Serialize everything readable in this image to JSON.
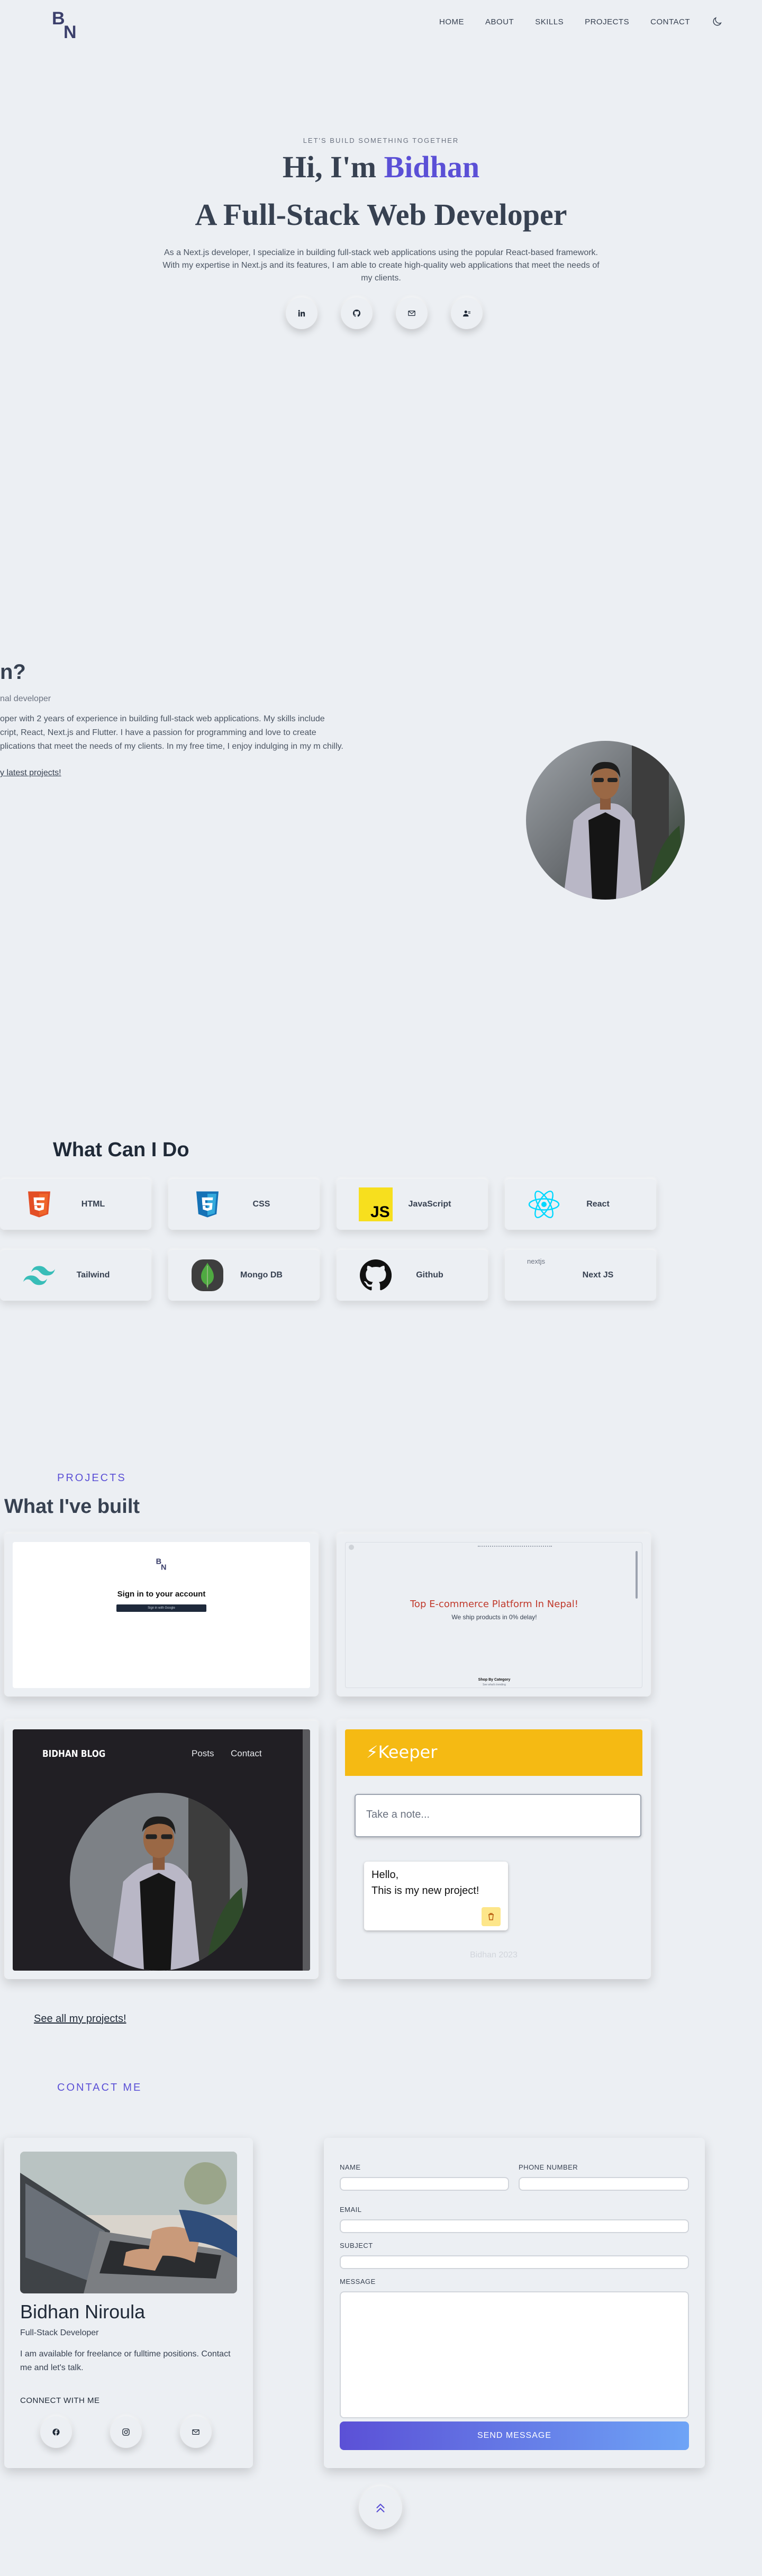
{
  "nav": {
    "logo_text": "BN",
    "items": [
      {
        "label": "HOME"
      },
      {
        "label": "ABOUT"
      },
      {
        "label": "SKILLS"
      },
      {
        "label": "PROJECTS"
      },
      {
        "label": "CONTACT"
      }
    ],
    "theme_icon": "moon-icon"
  },
  "hero": {
    "kicker": "LET'S BUILD SOMETHING TOGETHER",
    "greeting": "Hi, I'm ",
    "name": "Bidhan",
    "title": "A Full-Stack Web Developer",
    "description": "As a Next.js developer, I specialize in building full-stack web applications using the popular React-based framework. With my expertise in Next.js and its features, I am able to create high-quality web applications that meet the needs of my clients.",
    "socials": [
      {
        "icon": "linkedin-icon"
      },
      {
        "icon": "github-icon"
      },
      {
        "icon": "mail-icon"
      },
      {
        "icon": "contact-card-icon"
      }
    ]
  },
  "about": {
    "heading": "n?",
    "subheading": "nal developer",
    "paragraph": "oper with 2 years of experience in building full-stack web applications. My skills include cript, React, Next.js and Flutter. I have a passion for programming and love to create plications that meet the needs of my clients. In my free time, I enjoy indulging in my m chilly.",
    "link": "y latest projects!"
  },
  "skills": {
    "heading": "What Can I Do",
    "items": [
      {
        "label": "HTML",
        "icon": "html5-icon"
      },
      {
        "label": "CSS",
        "icon": "css3-icon"
      },
      {
        "label": "JavaScript",
        "icon": "javascript-icon"
      },
      {
        "label": "React",
        "icon": "react-icon"
      },
      {
        "label": "Tailwind",
        "icon": "tailwind-icon"
      },
      {
        "label": "Mongo DB",
        "icon": "mongodb-icon"
      },
      {
        "label": "Github",
        "icon": "github-icon"
      },
      {
        "label": "Next JS",
        "icon": "nextjs-icon",
        "alt": "nextjs"
      }
    ]
  },
  "projects": {
    "kicker": "PROJECTS",
    "heading": "What I've built",
    "signin": {
      "logo": "BN",
      "title": "Sign in to your account",
      "button": "Sign in with Google"
    },
    "ecommerce": {
      "headline": "Top E-commerce Platform In Nepal!",
      "sub": "We ship products in 0% delay!",
      "footer": "Shop By Category",
      "footer2": "See what's trending"
    },
    "blog": {
      "brand": "BIDHAN BLOG",
      "links": [
        "Posts",
        "Contact"
      ]
    },
    "keeper": {
      "brand": "Keeper",
      "placeholder": "Take a note...",
      "note_title": "Hello,",
      "note_body": "This is my new project!",
      "footer": "Bidhan 2023"
    },
    "see_all": "See all my projects!"
  },
  "contact": {
    "kicker": "CONTACT ME",
    "name": "Bidhan Niroula",
    "role": "Full-Stack Developer",
    "blurb": "I am available for freelance or fulltime positions. Contact me and let's talk.",
    "connect_label": "CONNECT WITH ME",
    "socials": [
      {
        "icon": "facebook-icon"
      },
      {
        "icon": "instagram-icon"
      },
      {
        "icon": "mail-icon"
      }
    ],
    "form": {
      "name_label": "NAME",
      "phone_label": "PHONE NUMBER",
      "email_label": "EMAIL",
      "subject_label": "SUBJECT",
      "message_label": "MESSAGE",
      "send_label": "SEND MESSAGE"
    }
  },
  "colors": {
    "accent": "#5b50d6",
    "background": "#eceff3",
    "text": "#374151"
  }
}
